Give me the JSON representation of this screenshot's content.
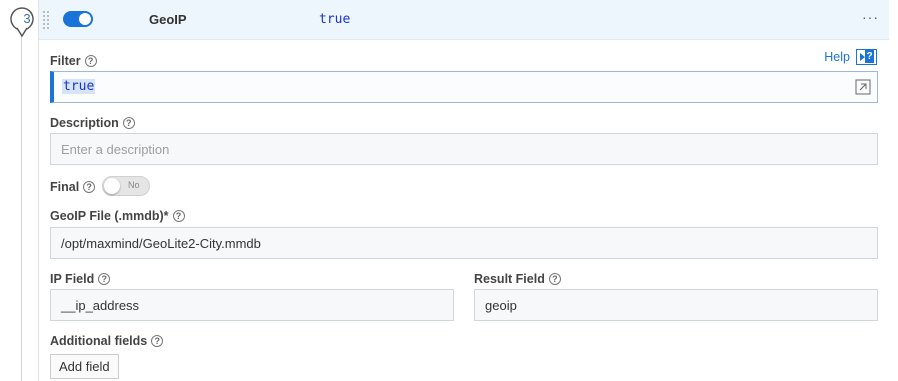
{
  "step": {
    "number": "3"
  },
  "header": {
    "enabled": true,
    "name": "GeoIP",
    "filter_value": "true"
  },
  "filter": {
    "label": "Filter",
    "value": "true",
    "help_label": "Help"
  },
  "description": {
    "label": "Description",
    "placeholder": "Enter a description"
  },
  "final": {
    "label": "Final",
    "toggle_text": "No"
  },
  "geoip_file": {
    "label": "GeoIP File (.mmdb)*",
    "value": "/opt/maxmind/GeoLite2-City.mmdb"
  },
  "ip_field": {
    "label": "IP Field",
    "value": "__ip_address"
  },
  "result_field": {
    "label": "Result Field",
    "value": "geoip"
  },
  "additional_fields": {
    "label": "Additional fields",
    "add_button": "Add field"
  },
  "colors": {
    "accent": "#1a73d9",
    "header_bg": "#eef6fd",
    "code_text": "#1a33cc"
  }
}
